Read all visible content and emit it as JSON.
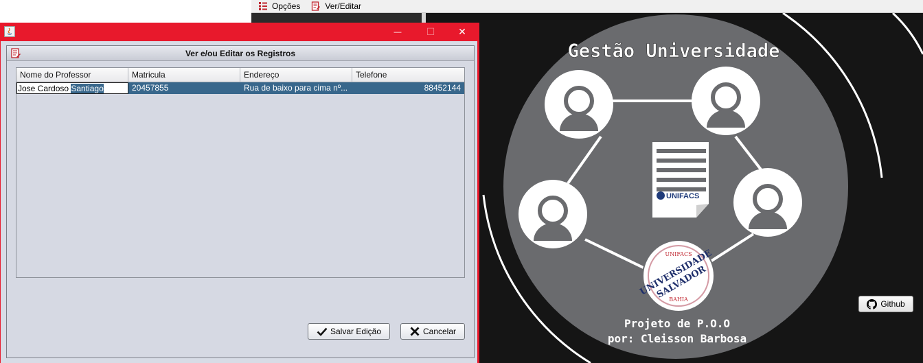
{
  "menu": {
    "items": [
      {
        "label": "Opções",
        "icon": "list-icon"
      },
      {
        "label": "Ver/Editar",
        "icon": "edit-document-icon"
      }
    ]
  },
  "background_art": {
    "title": "Gestão Universidade",
    "logo_text": "UNIFACS",
    "seal_top": "UNIFACS",
    "seal_main": "UNIVERSIDADE",
    "seal_sub": "SALVADOR",
    "seal_bottom": "BAHIA",
    "footer_line1": "Projeto de P.O.O",
    "footer_line2": "por: Cleisson Barbosa"
  },
  "github_button": {
    "label": "Github",
    "icon": "github-icon"
  },
  "dialog": {
    "title": "",
    "controls": {
      "minimize": "—",
      "maximize": "☐",
      "close": "✕"
    },
    "inner_title": "Ver e/ou Editar os Registros",
    "table": {
      "columns": [
        "Nome do Professor",
        "Matricula",
        "Endereço",
        "Telefone"
      ],
      "row": {
        "name_plain": "Jose Cardoso ",
        "name_selected": "Santiago",
        "matricula": "20457855",
        "endereco": "Rua de baixo para cima nº...",
        "telefone": "88452144"
      }
    },
    "buttons": {
      "save": "Salvar Edição",
      "cancel": "Cancelar"
    }
  },
  "colors": {
    "title_bar": "#e8192c",
    "selection": "#38678c",
    "dialog_body": "#d6d9e3"
  }
}
